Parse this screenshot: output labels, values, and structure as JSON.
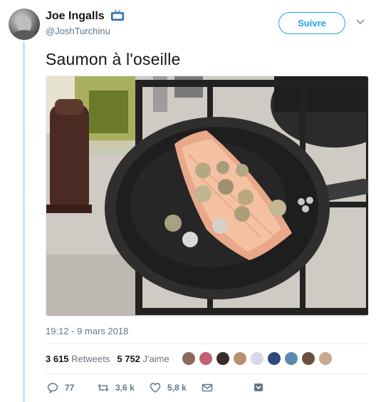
{
  "tweet": {
    "author_name": "Joe Ingalls",
    "author_handle": "@JoshTurchinu",
    "follow_label": "Suivre",
    "text": "Saumon à l'oseille",
    "timestamp": "19:12 - 9 mars 2018",
    "retweets_count": "3 615",
    "retweets_label": "Retweets",
    "likes_count": "5 752",
    "likes_label": "J'aime"
  },
  "actions": {
    "replies": "77",
    "retweets": "3,6 k",
    "likes": "5,8 k"
  },
  "liker_avatar_colors": [
    "#8a6a5a",
    "#c06070",
    "#3a2a2a",
    "#b89070",
    "#d8d8e8",
    "#2e4a7a",
    "#5a8ab0",
    "#6a5040",
    "#c8a890"
  ],
  "colors": {
    "accent": "#1da1f2",
    "thread_line": "#c4e5f7",
    "muted_text": "#657786"
  },
  "icons": [
    "tv-icon",
    "chevron-down-icon",
    "reply-icon",
    "retweet-icon",
    "heart-icon",
    "envelope-icon",
    "bookmark-icon"
  ]
}
